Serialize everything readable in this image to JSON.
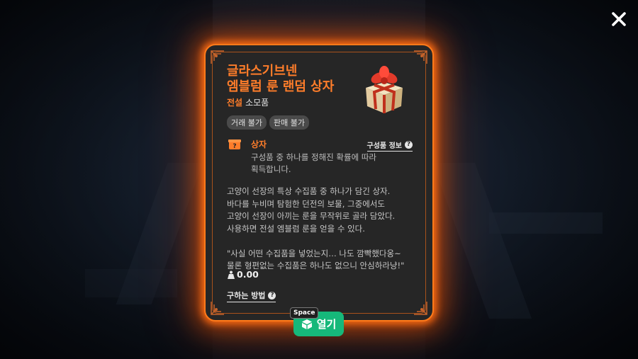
{
  "item": {
    "name_line1": "글라스기브넨",
    "name_line2": "엠블럼 룬 랜덤 상자",
    "grade": "전설",
    "type": "소모품",
    "tags": [
      "거래 불가",
      "판매 불가"
    ]
  },
  "box": {
    "label": "상자",
    "composition_label": "구성품 정보",
    "desc_line1": "구성품 중 하나를 정해진 확률에 따라",
    "desc_line2": "획득합니다."
  },
  "description": {
    "line1": "고양이 선장의 특상 수집품 중 하나가 담긴 상자.",
    "line2": "바다를 누비며 탐험한 던전의  보물, 그중에서도",
    "line3": "고양이 선장이 아끼는 룬을 무작위로 골라 담았다.",
    "line4": "사용하면 전설 엠블럼 룬을 얻을 수 있다.",
    "quote1": "\"사실 어떤 수집품을 넣었는지… 나도 깜빡했다옹~",
    "quote2": "물론 형편없는 수집품은 하나도 없으니 안심하라냥!\""
  },
  "weight": "0.00",
  "howto_label": "구하는 방법",
  "open_button": {
    "label": "열기",
    "hotkey": "Space"
  },
  "colors": {
    "accent": "#ff7d2a",
    "glow": "#ff6a00",
    "button": "#16b87a",
    "card_bg": "#262626"
  },
  "icons": {
    "close": "close-icon",
    "item": "gift-box-icon",
    "box": "mystery-box-icon",
    "help": "question-icon",
    "weight": "weight-icon",
    "open": "open-box-icon"
  }
}
